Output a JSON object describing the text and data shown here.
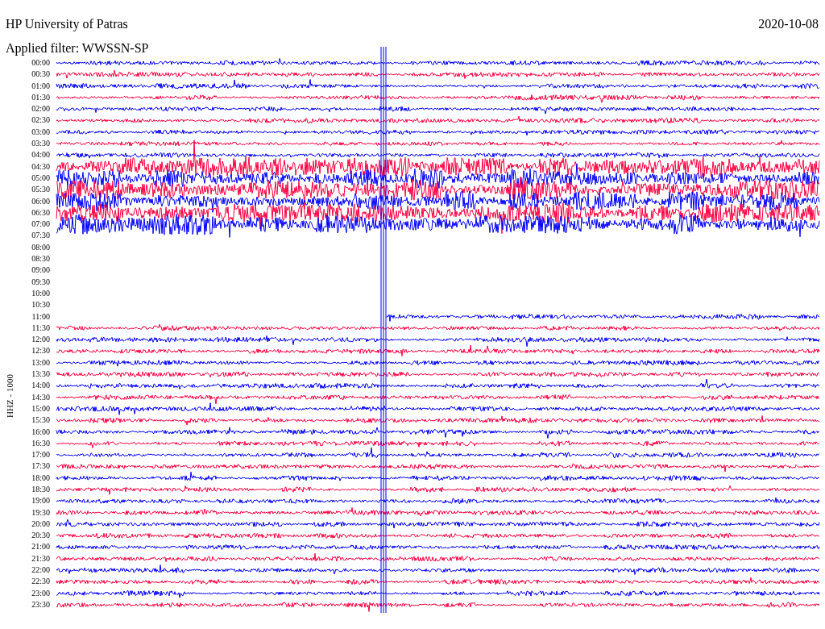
{
  "header": {
    "title": "HP University of Patras",
    "date": "2020-10-08",
    "filter": "Applied filter: WWSSN-SP"
  },
  "channel_label": "HHZ - 1000",
  "rows": [
    {
      "time": "00:00",
      "kind": "trace",
      "color": "#0000ff"
    },
    {
      "time": "00:30",
      "kind": "trace",
      "color": "#ff0040"
    },
    {
      "time": "01:00",
      "kind": "trace",
      "color": "#0000ff"
    },
    {
      "time": "01:30",
      "kind": "trace",
      "color": "#ff0040"
    },
    {
      "time": "02:00",
      "kind": "trace",
      "color": "#0000ff"
    },
    {
      "time": "02:30",
      "kind": "trace",
      "color": "#ff0040"
    },
    {
      "time": "03:00",
      "kind": "trace",
      "color": "#0000ff"
    },
    {
      "time": "03:30",
      "kind": "trace",
      "color": "#ff0040"
    },
    {
      "time": "04:00",
      "kind": "trace",
      "color": "#0000ff"
    },
    {
      "time": "04:30",
      "kind": "trace",
      "color": "#ff0040"
    },
    {
      "time": "05:00",
      "kind": "trace",
      "color": "#0000ff"
    },
    {
      "time": "05:30",
      "kind": "trace",
      "color": "#ff0040"
    },
    {
      "time": "06:00",
      "kind": "trace",
      "color": "#0000ff"
    },
    {
      "time": "06:30",
      "kind": "trace",
      "color": "#ff0040"
    },
    {
      "time": "07:00",
      "kind": "trace",
      "color": "#0000ff"
    },
    {
      "time": "07:30",
      "kind": "gap"
    },
    {
      "time": "08:00",
      "kind": "gap"
    },
    {
      "time": "08:30",
      "kind": "gap"
    },
    {
      "time": "09:00",
      "kind": "gap"
    },
    {
      "time": "09:30",
      "kind": "gap"
    },
    {
      "time": "10:00",
      "kind": "gap"
    },
    {
      "time": "10:30",
      "kind": "gap"
    },
    {
      "time": "11:00",
      "kind": "trace",
      "color": "#0000ff"
    },
    {
      "time": "11:30",
      "kind": "trace",
      "color": "#ff0040"
    },
    {
      "time": "12:00",
      "kind": "trace",
      "color": "#0000ff"
    },
    {
      "time": "12:30",
      "kind": "trace",
      "color": "#ff0040"
    },
    {
      "time": "13:00",
      "kind": "trace",
      "color": "#0000ff"
    },
    {
      "time": "13:30",
      "kind": "trace",
      "color": "#ff0040"
    },
    {
      "time": "14:00",
      "kind": "trace",
      "color": "#0000ff"
    },
    {
      "time": "14:30",
      "kind": "trace",
      "color": "#ff0040"
    },
    {
      "time": "15:00",
      "kind": "trace",
      "color": "#0000ff"
    },
    {
      "time": "15:30",
      "kind": "trace",
      "color": "#ff0040"
    },
    {
      "time": "16:00",
      "kind": "trace",
      "color": "#0000ff"
    },
    {
      "time": "16:30",
      "kind": "trace",
      "color": "#ff0040"
    },
    {
      "time": "17:00",
      "kind": "trace",
      "color": "#0000ff"
    },
    {
      "time": "17:30",
      "kind": "trace",
      "color": "#ff0040"
    },
    {
      "time": "18:00",
      "kind": "trace",
      "color": "#0000ff"
    },
    {
      "time": "18:30",
      "kind": "trace",
      "color": "#ff0040"
    },
    {
      "time": "19:00",
      "kind": "trace",
      "color": "#0000ff"
    },
    {
      "time": "19:30",
      "kind": "trace",
      "color": "#ff0040"
    },
    {
      "time": "20:00",
      "kind": "trace",
      "color": "#0000ff"
    },
    {
      "time": "20:30",
      "kind": "trace",
      "color": "#ff0040"
    },
    {
      "time": "21:00",
      "kind": "trace",
      "color": "#0000ff"
    },
    {
      "time": "21:30",
      "kind": "trace",
      "color": "#ff0040"
    },
    {
      "time": "22:00",
      "kind": "trace",
      "color": "#0000ff"
    },
    {
      "time": "22:30",
      "kind": "trace",
      "color": "#ff0040"
    },
    {
      "time": "23:00",
      "kind": "trace",
      "color": "#0000ff"
    },
    {
      "time": "23:30",
      "kind": "trace",
      "color": "#ff0040"
    }
  ]
}
